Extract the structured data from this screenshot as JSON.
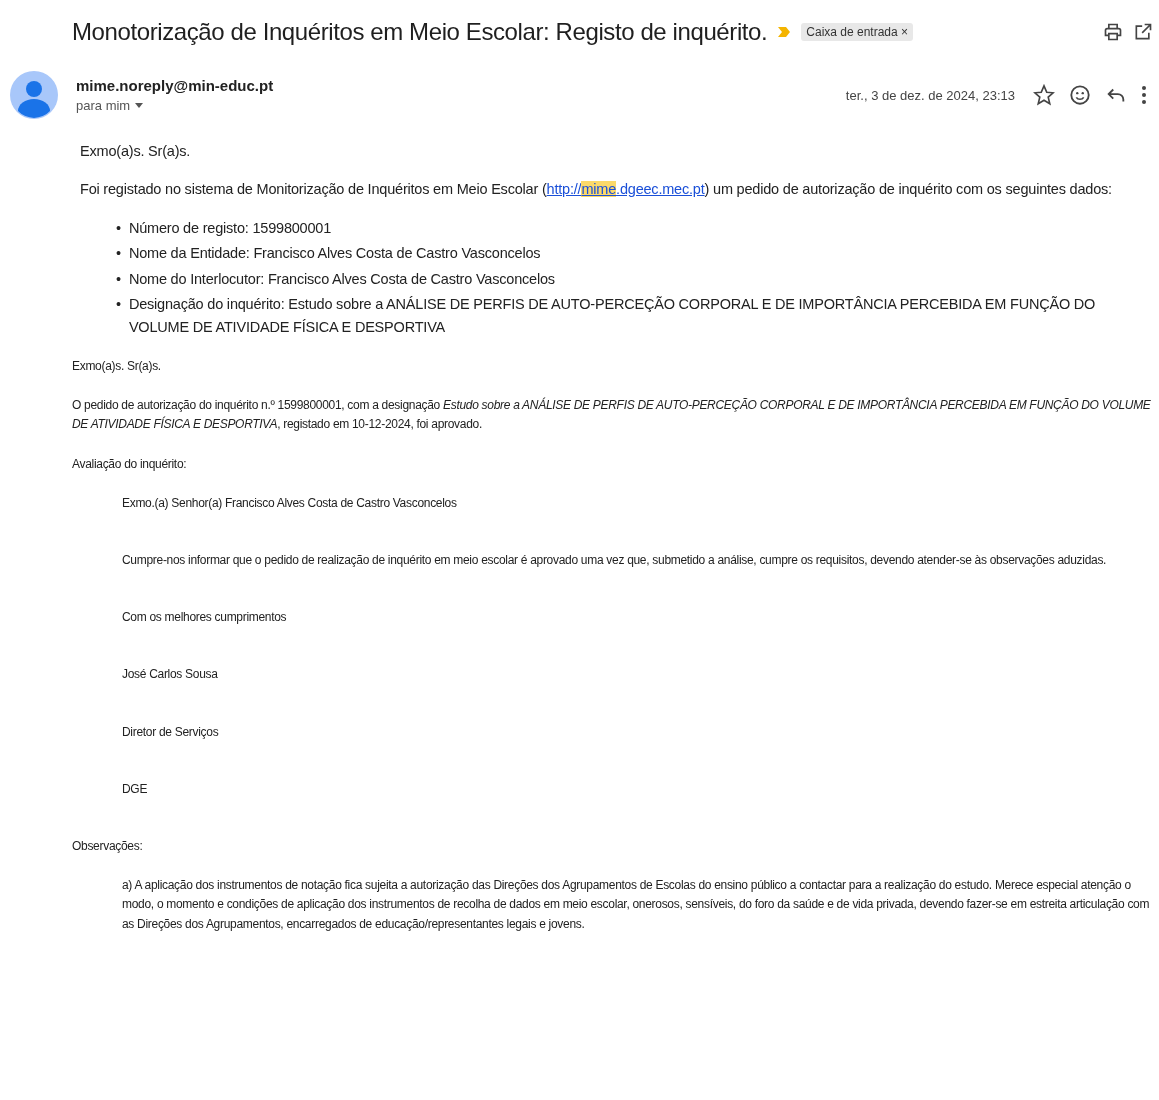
{
  "subject": "Monotorização de Inquéritos em Meio Escolar: Registo de inquérito.",
  "label": {
    "text": "Caixa de entrada",
    "remove": "×"
  },
  "sender": {
    "email": "mime.noreply@min-educ.pt",
    "recipient": "para mim"
  },
  "date": "ter., 3 de dez. de 2024, 23:13",
  "starred": false,
  "body": {
    "greeting": "Exmo(a)s. Sr(a)s.",
    "intro": {
      "before": "Foi registado no sistema de Monitorização de Inquéritos em Meio Escolar (",
      "link_start": "http://",
      "link_highlight": "mime",
      "link_end": ".dgeec.mec.pt",
      "after": ") um pedido de autorização de inquérito com os seguintes dados:"
    },
    "items": [
      {
        "bullet": "•",
        "text": "Número de registo: 1599800001"
      },
      {
        "bullet": "•",
        "text": "Nome da Entidade: Francisco Alves Costa de Castro Vasconcelos"
      },
      {
        "bullet": "•",
        "text": "Nome do Interlocutor: Francisco Alves Costa de Castro Vasconcelos"
      },
      {
        "bullet": "•",
        "text": "Designação do inquérito: Estudo sobre a ANÁLISE DE PERFIS DE AUTO-PERCEÇÃO CORPORAL E DE IMPORTÂNCIA PERCEBIDA EM FUNÇÃO DO VOLUME DE ATIVIDADE FÍSICA E DESPORTIVA"
      }
    ]
  },
  "notice": {
    "greeting": "Exmo(a)s. Sr(a)s.",
    "approval": "O pedido de autorização do inquérito n.º 1599800001, com a designação *Estudo sobre a ANÁLISE DE PERFIS DE AUTO-PERCEÇÃO CORPORAL E DE IMPORTÂNCIA PERCEBIDA EM FUNÇÃO DO VOLUME DE ATIVIDADE FÍSICA E DESPORTIVA*, registado em 10-12-2024, foi aprovado.",
    "evaluation_heading": "Avaliação do inquérito:",
    "evaluation": [
      "Exmo.(a) Senhor(a) Francisco Alves Costa de Castro Vasconcelos",
      "Cumpre-nos informar que o pedido de realização de inquérito em meio escolar é aprovado uma vez que, submetido a análise, cumpre os requisitos, devendo atender-se às observações aduzidas.",
      "Com os melhores cumprimentos",
      "José Carlos Sousa",
      "Diretor de Serviços",
      "DGE"
    ],
    "observations_heading": "Observações:",
    "observations": [
      "a) A aplicação dos instrumentos de notação fica sujeita a autorização das Direções dos Agrupamentos de Escolas do ensino público a contactar para a realização do estudo. Merece especial atenção o modo, o momento e condições de aplicação dos instrumentos de recolha de dados em meio escolar, onerosos, sensíveis, do foro da saúde e de vida privada, devendo fazer-se em estreita articulação com as Direções dos Agrupamentos, encarregados de educação/representantes legais e jovens."
    ]
  }
}
